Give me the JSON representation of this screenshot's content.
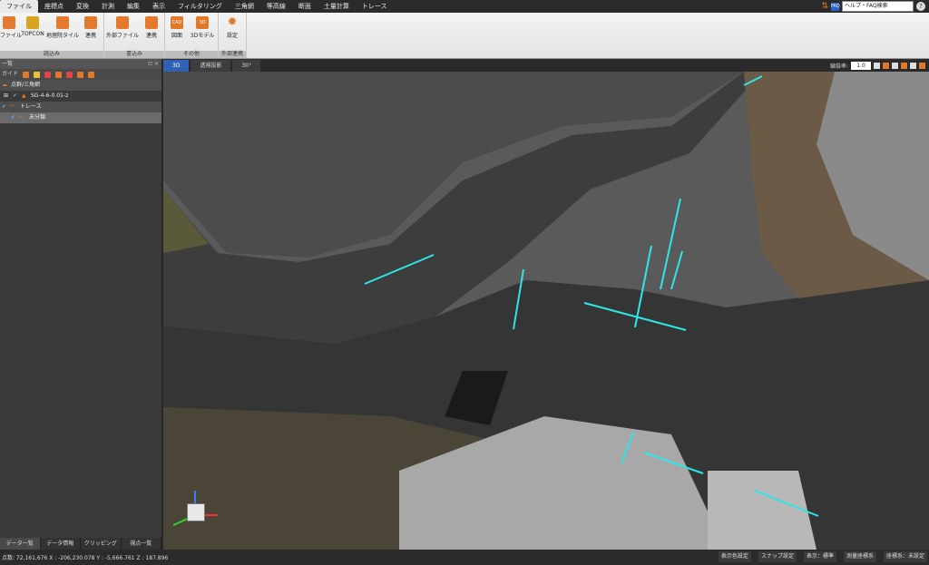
{
  "menu": [
    "ファイル",
    "座標点",
    "変換",
    "計測",
    "編集",
    "表示",
    "フィルタリング",
    "三角網",
    "等高線",
    "断面",
    "土量計算",
    "トレース"
  ],
  "search": {
    "label": "ヘルプ・FAQ検索",
    "help": "?"
  },
  "ribbon": {
    "groups": [
      {
        "label": "読込み",
        "buttons": [
          "ファイル",
          "TOPCON",
          "地理院タイル",
          "連携"
        ]
      },
      {
        "label": "書込み",
        "buttons": [
          "外部ファイル",
          "連携"
        ]
      },
      {
        "label": "その他",
        "buttons": [
          "図面",
          "3Dモデル"
        ]
      },
      {
        "label": "外部連携",
        "buttons": [
          "設定"
        ]
      }
    ],
    "icons": {
      "cad": "CAD",
      "three_d": "3D"
    }
  },
  "left_panel": {
    "title": "一覧",
    "toolbar_label": "ガイド",
    "tree": [
      {
        "label": "点群/三角網"
      },
      {
        "label": "SG-4-6-0.01-z"
      },
      {
        "label": "トレース"
      },
      {
        "label": "未分類"
      }
    ]
  },
  "bottom_tabs": [
    "データ一覧",
    "データ情報",
    "クリッピング",
    "視点一覧"
  ],
  "view_tabs": [
    "3D",
    "透視投影",
    "30°"
  ],
  "view_zoom": {
    "label": "縮倍率:",
    "value": "1.0"
  },
  "status": {
    "left": "点数: 72,161,676    X : -206,230.078  Y : -5,666.761  Z : 187.896",
    "right": [
      "表示色設定",
      "スナップ設定",
      "表示：標準",
      "測量座標系",
      "座標系：未設定"
    ]
  },
  "colors": {
    "accent": "#2f62b4",
    "trace": "#2ee6e6",
    "orange": "#e07a2a"
  }
}
